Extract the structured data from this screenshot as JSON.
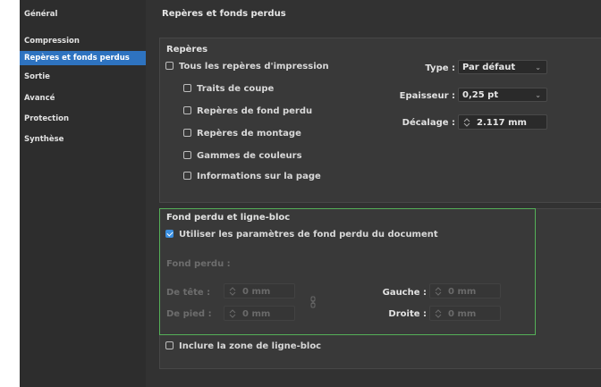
{
  "sidebar": {
    "items": [
      {
        "label": "Général",
        "selected": false
      },
      {
        "label": "Compression",
        "selected": false
      },
      {
        "label": "Repères et fonds perdus",
        "selected": true
      },
      {
        "label": "Sortie",
        "selected": false
      },
      {
        "label": "Avancé",
        "selected": false
      },
      {
        "label": "Protection",
        "selected": false
      },
      {
        "label": "Synthèse",
        "selected": false
      }
    ]
  },
  "main": {
    "title": "Repères et fonds perdus",
    "marks": {
      "heading": "Repères",
      "all_marks": {
        "label": "Tous les repères d'impression",
        "checked": false
      },
      "items": [
        {
          "label": "Traits de coupe",
          "checked": false
        },
        {
          "label": "Repères de fond perdu",
          "checked": false
        },
        {
          "label": "Repères de montage",
          "checked": false
        },
        {
          "label": "Gammes de couleurs",
          "checked": false
        },
        {
          "label": "Informations sur la page",
          "checked": false
        }
      ],
      "type_label": "Type :",
      "type_value": "Par défaut",
      "weight_label": "Epaisseur :",
      "weight_value": "0,25 pt",
      "offset_label": "Décalage :",
      "offset_value": "2.117 mm"
    },
    "bleed": {
      "heading": "Fond perdu et ligne-bloc",
      "use_doc": {
        "label": "Utiliser les paramètres de fond perdu du document",
        "checked": true
      },
      "bleed_label": "Fond perdu :",
      "top_label": "De tête :",
      "top_value": "0 mm",
      "bottom_label": "De pied :",
      "bottom_value": "0 mm",
      "left_label": "Gauche :",
      "left_value": "0 mm",
      "right_label": "Droite :",
      "right_value": "0 mm",
      "slug": {
        "label": "Inclure la zone de ligne-bloc",
        "checked": false
      }
    }
  },
  "colors": {
    "accent": "#2e73c0",
    "checkbox_checked": "#3a8fe0",
    "highlight": "#55b058"
  }
}
